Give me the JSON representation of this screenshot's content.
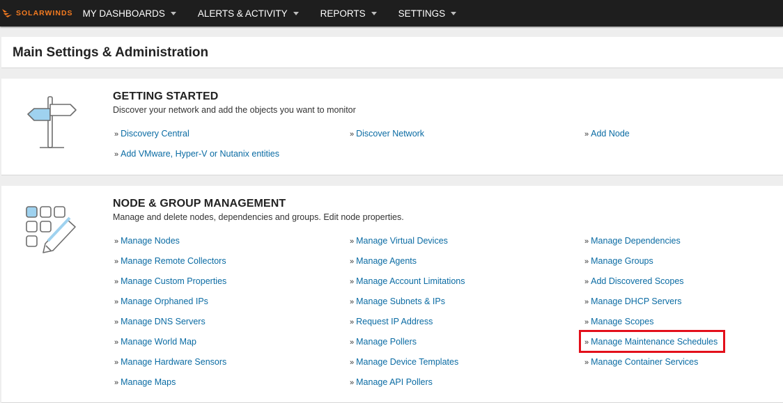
{
  "nav": {
    "logo_text": "SOLARWINDS",
    "items": [
      {
        "label": "MY DASHBOARDS"
      },
      {
        "label": "ALERTS & ACTIVITY"
      },
      {
        "label": "REPORTS"
      },
      {
        "label": "SETTINGS"
      }
    ]
  },
  "page": {
    "title": "Main Settings & Administration"
  },
  "getting_started": {
    "icon": "signpost-icon",
    "title": "GETTING STARTED",
    "description": "Discover your network and add the objects you want to monitor",
    "links": [
      "Discovery Central",
      "Discover Network",
      "Add Node",
      "Add VMware, Hyper-V or Nutanix entities"
    ]
  },
  "node_group": {
    "icon": "grid-pencil-icon",
    "title": "NODE & GROUP MANAGEMENT",
    "description": "Manage and delete nodes, dependencies and groups. Edit node properties.",
    "links": [
      "Manage Nodes",
      "Manage Virtual Devices",
      "Manage Dependencies",
      "Manage Remote Collectors",
      "Manage Agents",
      "Manage Groups",
      "Manage Custom Properties",
      "Manage Account Limitations",
      "Add Discovered Scopes",
      "Manage Orphaned IPs",
      "Manage Subnets & IPs",
      "Manage DHCP Servers",
      "Manage DNS Servers",
      "Request IP Address",
      "Manage Scopes",
      "Manage World Map",
      "Manage Pollers",
      "Manage Maintenance Schedules",
      "Manage Hardware Sensors",
      "Manage Device Templates",
      "Manage Container Services",
      "Manage Maps",
      "Manage API Pollers"
    ]
  },
  "colors": {
    "nav_bg": "#1e1e1e",
    "brand_orange": "#f47b20",
    "link_blue": "#0a6ba3",
    "highlight_red": "#e3101b"
  }
}
